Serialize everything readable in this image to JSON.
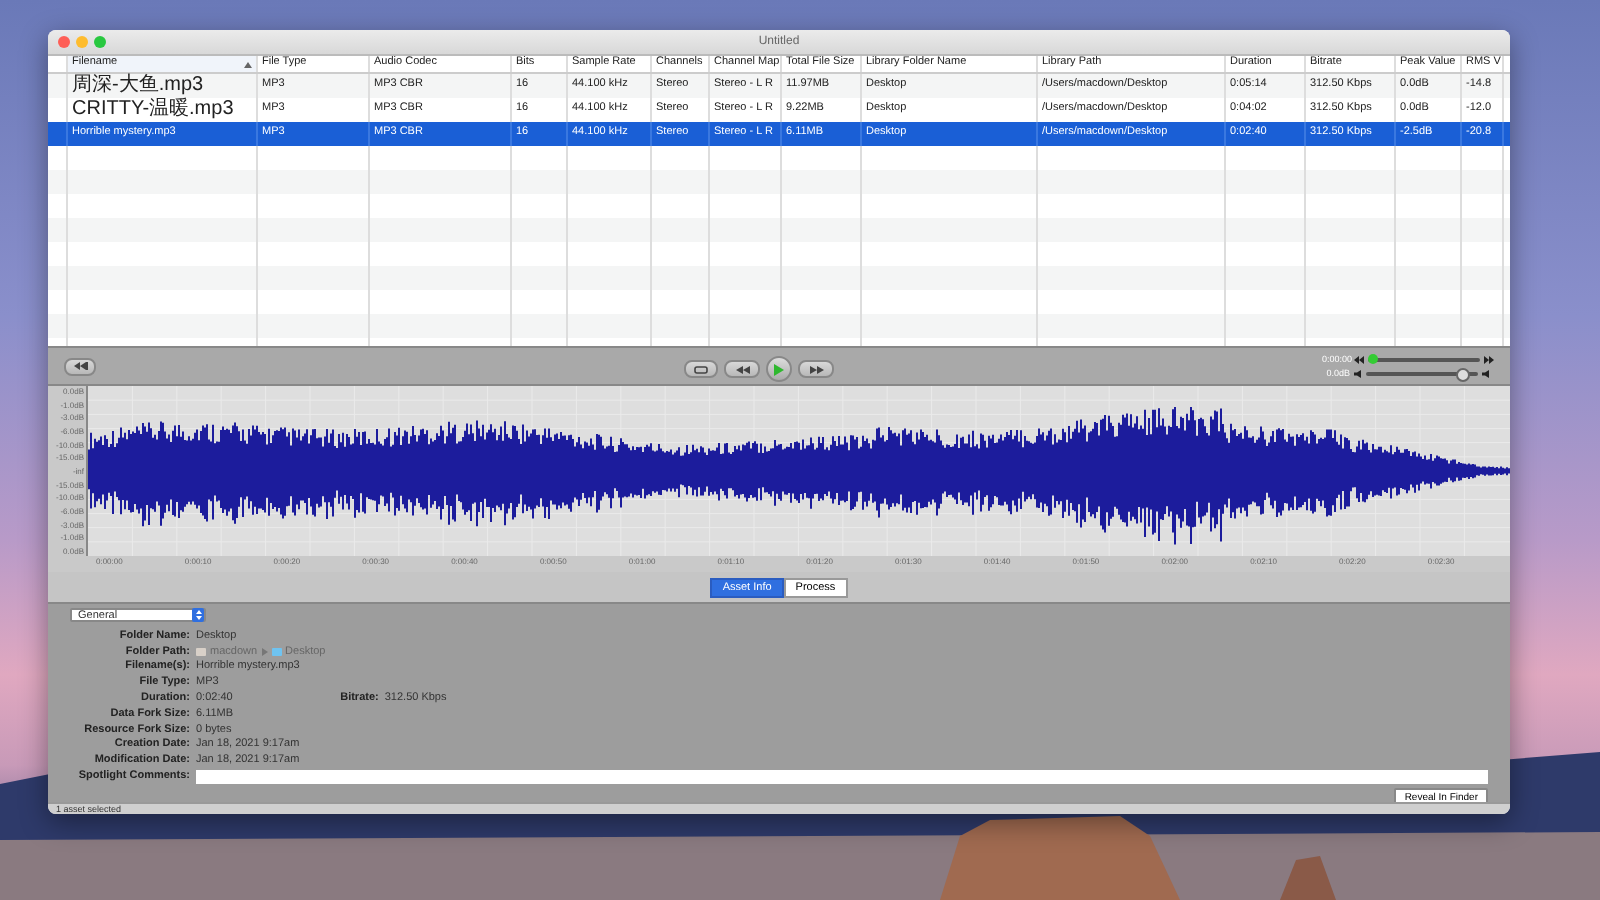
{
  "window": {
    "title": "Untitled"
  },
  "table": {
    "columns": [
      {
        "label": "Filename",
        "sorted": true
      },
      {
        "label": "File Type",
        "sorted": false
      },
      {
        "label": "Audio Codec",
        "sorted": false
      },
      {
        "label": "Bits",
        "sorted": false
      },
      {
        "label": "Sample Rate",
        "sorted": false
      },
      {
        "label": "Channels",
        "sorted": false
      },
      {
        "label": "Channel Map",
        "sorted": false
      },
      {
        "label": "Total File Size",
        "sorted": false
      },
      {
        "label": "Library Folder Name",
        "sorted": false
      },
      {
        "label": "Library Path",
        "sorted": false
      },
      {
        "label": "Duration",
        "sorted": false
      },
      {
        "label": "Bitrate",
        "sorted": false
      },
      {
        "label": "Peak Value",
        "sorted": false
      },
      {
        "label": "RMS V",
        "sorted": false
      }
    ],
    "rows": [
      {
        "selected": false,
        "cells": [
          "周深-大鱼.mp3",
          "MP3",
          "MP3 CBR",
          "16",
          "44.100 kHz",
          "Stereo",
          "Stereo - L R",
          "11.97MB",
          "Desktop",
          "/Users/macdown/Desktop",
          "0:05:14",
          "312.50 Kbps",
          "0.0dB",
          "-14.8"
        ]
      },
      {
        "selected": false,
        "cells": [
          "CRITTY-温暖.mp3",
          "MP3",
          "MP3 CBR",
          "16",
          "44.100 kHz",
          "Stereo",
          "Stereo - L R",
          "9.22MB",
          "Desktop",
          "/Users/macdown/Desktop",
          "0:04:02",
          "312.50 Kbps",
          "0.0dB",
          "-12.0"
        ]
      },
      {
        "selected": true,
        "cells": [
          "Horrible mystery.mp3",
          "MP3",
          "MP3 CBR",
          "16",
          "44.100 kHz",
          "Stereo",
          "Stereo - L R",
          "6.11MB",
          "Desktop",
          "/Users/macdown/Desktop",
          "0:02:40",
          "312.50 Kbps",
          "-2.5dB",
          "-20.8"
        ]
      }
    ]
  },
  "transport": {
    "position": {
      "reading": "0:00:00",
      "level": 0.04
    },
    "volume": {
      "reading": "0.0dB",
      "level": 0.85
    }
  },
  "waveform": {
    "y_labels": [
      "0.0dB",
      "-1.0dB",
      "-3.0dB",
      "-6.0dB",
      "-10.0dB",
      "-15.0dB",
      "-inf",
      "-15.0dB",
      "-10.0dB",
      "-6.0dB",
      "-3.0dB",
      "-1.0dB",
      "0.0dB"
    ],
    "x_labels": [
      "0:00:00",
      "0:00:10",
      "0:00:20",
      "0:00:30",
      "0:00:40",
      "0:00:50",
      "0:01:00",
      "0:01:10",
      "0:01:20",
      "0:01:30",
      "0:01:40",
      "0:01:50",
      "0:02:00",
      "0:02:10",
      "0:02:20",
      "0:02:30"
    ]
  },
  "tabs": [
    {
      "label": "Asset Info",
      "selected": true
    },
    {
      "label": "Process",
      "selected": false
    }
  ],
  "info": {
    "view": "General",
    "fields": [
      {
        "kind": "text",
        "label": "Folder Name:",
        "value": "Desktop"
      },
      {
        "kind": "path",
        "label": "Folder Path:",
        "parts": [
          "macdown",
          "Desktop"
        ]
      },
      {
        "kind": "text",
        "label": "Filename(s):",
        "value": "Horrible mystery.mp3"
      },
      {
        "kind": "text",
        "label": "File Type:",
        "value": "MP3"
      },
      {
        "kind": "text",
        "label": "Duration:",
        "value": "0:02:40",
        "extra_label": "Bitrate:",
        "extra_value": "312.50 Kbps"
      },
      {
        "kind": "text",
        "label": "Data Fork Size:",
        "value": "6.11MB"
      },
      {
        "kind": "text",
        "label": "Resource Fork Size:",
        "value": "0 bytes"
      },
      {
        "kind": "text",
        "label": "Creation Date:",
        "value": "Jan 18, 2021 9:17am"
      },
      {
        "kind": "text",
        "label": "Modification Date:",
        "value": "Jan 18, 2021 9:17am"
      },
      {
        "kind": "input",
        "label": "Spotlight Comments:"
      }
    ],
    "button": "Reveal In Finder"
  },
  "status_bar": "1 asset selected"
}
